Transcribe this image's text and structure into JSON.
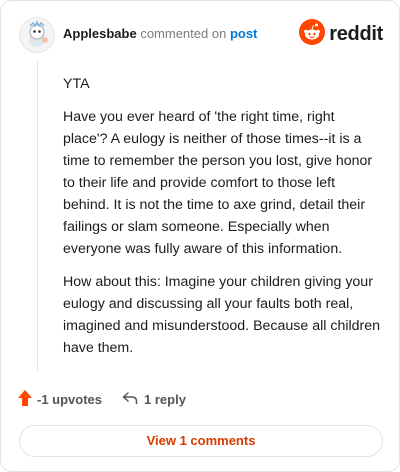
{
  "comment": {
    "username": "Applesbabe",
    "action_text": "commented on",
    "post_link": "post",
    "brand": "reddit",
    "paragraphs": [
      "YTA",
      "Have you ever heard of 'the right time, right place'? A eulogy is neither of those times--it is a time to remember the person you lost, give honor to their life and provide comfort to those left behind. It is not the time to axe grind, detail their failings or slam someone. Especially when everyone was fully aware of this information.",
      "How about this: Imagine your children giving your eulogy and discussing all your faults both real, imagined and misunderstood. Because all children have them."
    ],
    "votes_label": "-1 upvotes",
    "replies_label": "1 reply",
    "view_comments_label": "View 1 comments"
  },
  "colors": {
    "reddit_orange": "#ff4500",
    "link_blue": "#0079d3",
    "view_button_text": "#d93a00"
  },
  "icons": {
    "avatar": "snoo-avatar-icon",
    "brand": "reddit-logo-icon",
    "upvote": "upvote-arrow-icon",
    "reply": "reply-arrow-icon"
  }
}
